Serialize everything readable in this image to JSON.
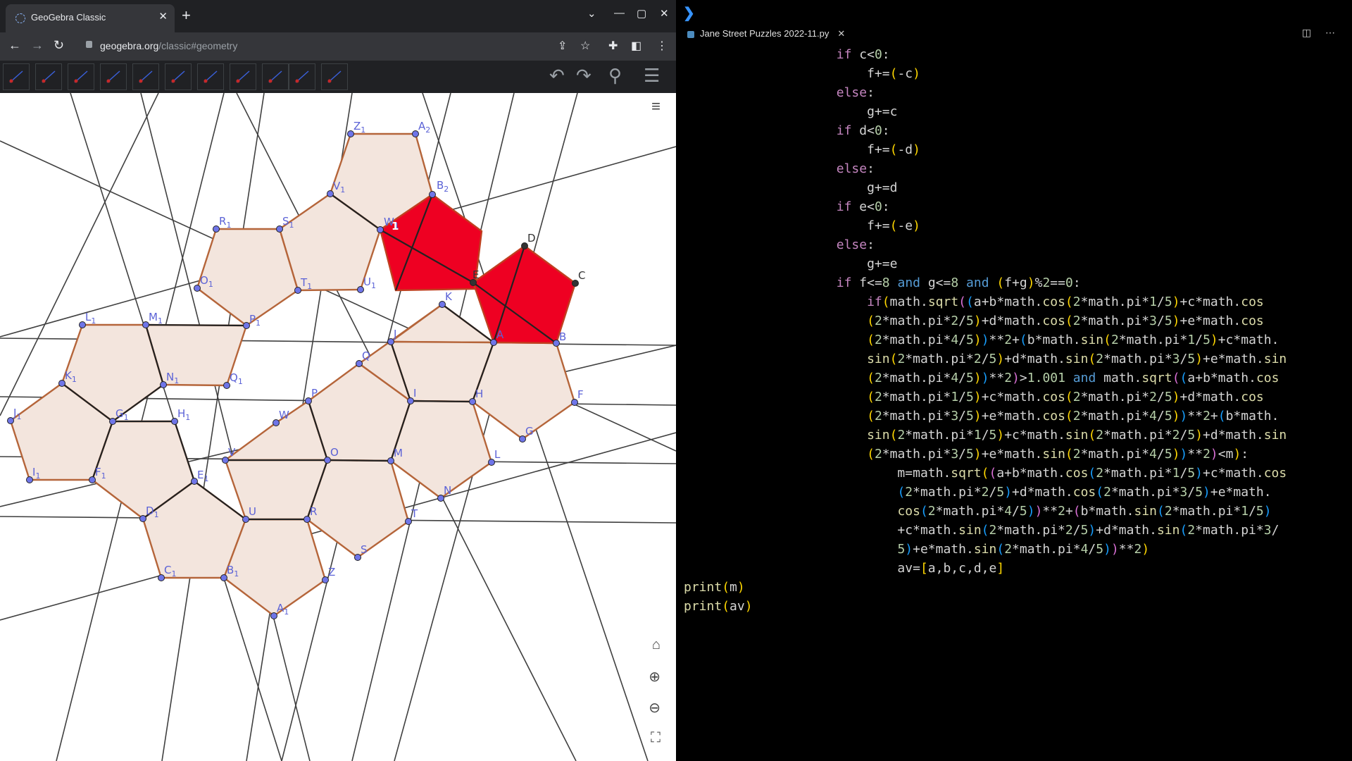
{
  "browser": {
    "tab_title": "GeoGebra Classic",
    "url_host": "geogebra.org",
    "url_path": "/classic#geometry"
  },
  "geogebra": {
    "toolbar_tools": [
      "move-tool",
      "polygon-tool",
      "line-tool",
      "perpendicular-tool",
      "regular-polygon-tool",
      "point-tool",
      "circle-tool",
      "angle-tool",
      "reflect-tool",
      "slider-tool",
      "move-view-tool"
    ],
    "colors": {
      "polygon_fill": "#f3e5dd",
      "polygon_edge": "#b5653a",
      "highlight_fill": "#ee0022",
      "point": "#6f75e8",
      "label": "#5b62d6",
      "line": "#404040"
    },
    "point_labels": {
      "Z1": "Z",
      "A2": "A",
      "B2": "B",
      "V1": "V",
      "W1": "W",
      "R1": "R",
      "S1": "S",
      "O1": "O",
      "T1": "T",
      "U1": "U",
      "L1": "L",
      "M1": "M",
      "P1": "P",
      "K1": "K",
      "N1": "N",
      "Q1": "Q",
      "J1": "J",
      "G1": "G",
      "H1": "H",
      "I1": "I",
      "F1": "F",
      "E1": "E",
      "D1": "D",
      "C1": "C",
      "B1": "B",
      "A1": "A",
      "D": "D",
      "C": "C",
      "E": "E",
      "K": "K",
      "J": "J",
      "A": "A",
      "B": "B",
      "Q": "Q",
      "I": "I",
      "H": "H",
      "F": "F",
      "P": "P",
      "W": "W",
      "G": "G",
      "V": "V",
      "O": "O",
      "M": "M",
      "L": "L",
      "N": "N",
      "U": "U",
      "R": "R",
      "T": "T",
      "S": "S",
      "Z": "Z"
    },
    "point_subscripts": {
      "Z1": "1",
      "A2": "2",
      "B2": "2",
      "V1": "1",
      "W1": "1",
      "R1": "1",
      "S1": "1",
      "O1": "1",
      "T1": "1",
      "U1": "1",
      "L1": "1",
      "M1": "1",
      "P1": "1",
      "K1": "1",
      "N1": "1",
      "Q1": "1",
      "J1": "1",
      "G1": "1",
      "H1": "1",
      "I1": "1",
      "F1": "1",
      "E1": "1",
      "D1": "1",
      "C1": "1",
      "B1": "1",
      "A1": "1"
    },
    "value_badge": "1"
  },
  "editor": {
    "file_name": "Jane Street Puzzles 2022-11.py",
    "lines": [
      "                    if c<0:",
      "                        f+=(-c)",
      "                    else:",
      "                        g+=c",
      "                    if d<0:",
      "                        f+=(-d)",
      "                    else:",
      "                        g+=d",
      "                    if e<0:",
      "                        f+=(-e)",
      "                    else:",
      "                        g+=e",
      "                    if f<=8 and g<=8 and (f+g)%2==0:",
      "                        if(math.sqrt((a+b*math.cos(2*math.pi*1/5)+c*math.cos",
      "                        (2*math.pi*2/5)+d*math.cos(2*math.pi*3/5)+e*math.cos",
      "                        (2*math.pi*4/5))**2+(b*math.sin(2*math.pi*1/5)+c*math.",
      "                        sin(2*math.pi*2/5)+d*math.sin(2*math.pi*3/5)+e*math.sin",
      "                        (2*math.pi*4/5))**2)>1.001 and math.sqrt((a+b*math.cos",
      "                        (2*math.pi*1/5)+c*math.cos(2*math.pi*2/5)+d*math.cos",
      "                        (2*math.pi*3/5)+e*math.cos(2*math.pi*4/5))**2+(b*math.",
      "                        sin(2*math.pi*1/5)+c*math.sin(2*math.pi*2/5)+d*math.sin",
      "                        (2*math.pi*3/5)+e*math.sin(2*math.pi*4/5))**2)<m):",
      "                            m=math.sqrt((a+b*math.cos(2*math.pi*1/5)+c*math.cos",
      "                            (2*math.pi*2/5)+d*math.cos(2*math.pi*3/5)+e*math.",
      "                            cos(2*math.pi*4/5))**2+(b*math.sin(2*math.pi*1/5)",
      "                            +c*math.sin(2*math.pi*2/5)+d*math.sin(2*math.pi*3/",
      "                            5)+e*math.sin(2*math.pi*4/5))**2)",
      "                            av=[a,b,c,d,e]",
      "print(m)",
      "print(av)"
    ]
  }
}
